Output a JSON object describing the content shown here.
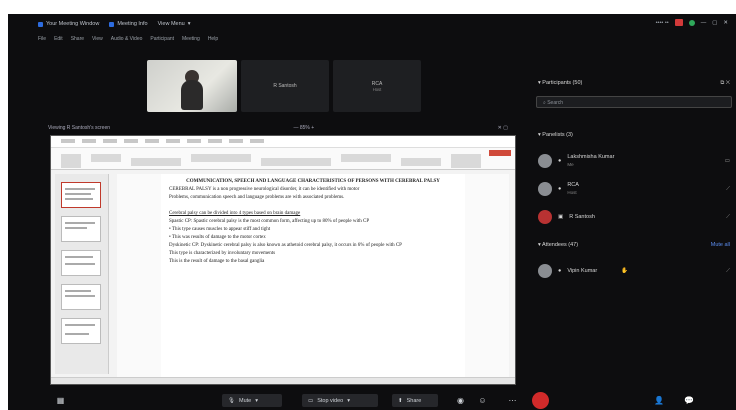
{
  "titlebar": {
    "items": [
      "Your Meeting Window",
      "Meeting Info",
      "View Menu"
    ]
  },
  "menubar": [
    "File",
    "Edit",
    "Share",
    "View",
    "Audio & Video",
    "Participant",
    "Meeting",
    "Help"
  ],
  "tiles": [
    {
      "label": ""
    },
    {
      "label": "R Santosh"
    },
    {
      "label": "RCA",
      "sub": "Host"
    }
  ],
  "share": {
    "label": "Viewing R Santosh's screen",
    "zoom": "85%"
  },
  "slide": {
    "title": "COMMUNICATION, SPEECH AND LANGUAGE CHARACTERISTICS OF PERSONS WITH CEREBRAL PALSY",
    "lines": [
      "CEREBRAL PALSY is a non progressive neurological disorder, it can be identified with motor",
      "Problems, communication speech and language problems are with associated problems.",
      "",
      "Cerebral palsy can be divided into 4 types based on brain damage",
      "Spastic CP: Spastic cerebral palsy is the most common form, affecting up to 80% of people with CP",
      "• This type causes muscles to appear stiff and tight",
      "• This was results of damage to the motor cortex",
      "Dyskinetic CP: Dyskinetic cerebral palsy is also known as athetoid cerebral palsy, it occurs in 6% of people with CP",
      "This type is characterized by involuntary movements",
      "This is the result of damage to the basal ganglia"
    ]
  },
  "panel": {
    "participants_title": "Participants (50)",
    "search_placeholder": "Search",
    "panelists_title": "Panelists (3)",
    "panelists": [
      {
        "name": "Lakshmisha Kumar",
        "role": "Me"
      },
      {
        "name": "RCA",
        "role": "Host"
      },
      {
        "name": "R Santosh",
        "role": ""
      }
    ],
    "attendees_title": "Attendees (47)",
    "attendees_action": "Mute all",
    "attendees": [
      {
        "name": "Vipin Kumar"
      }
    ]
  },
  "toolbar": {
    "mute_label": "Mute",
    "share_label": "Stop video",
    "share2_label": "Share"
  },
  "colors": {
    "accent": "#2d6cdf",
    "leave": "#d12a2a",
    "record": "#d23a3a",
    "bg": "#0d0d0f"
  }
}
